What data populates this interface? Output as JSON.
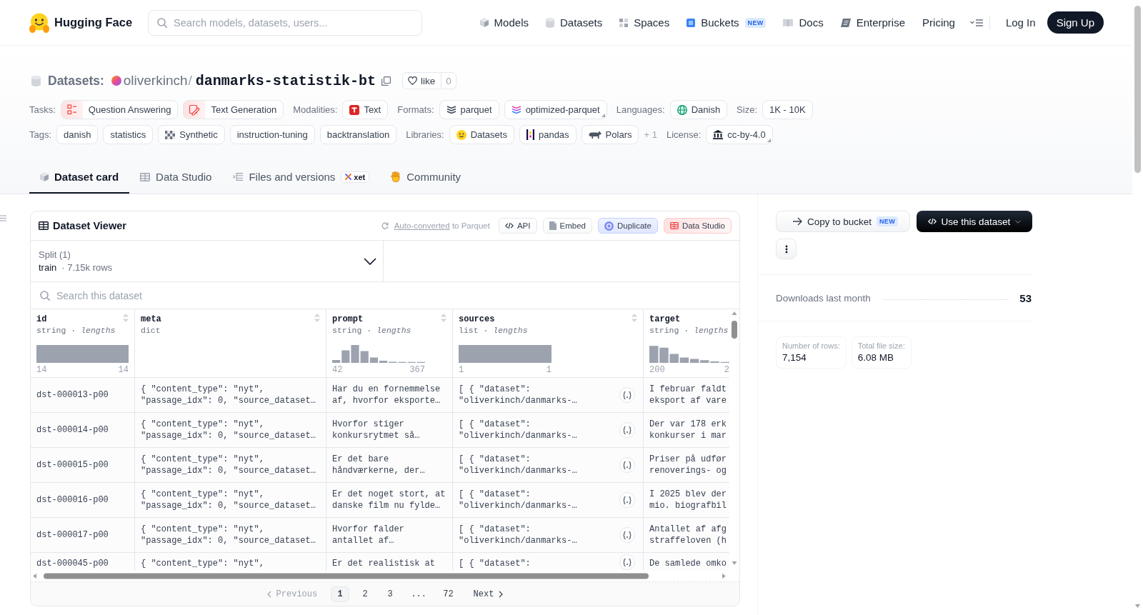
{
  "header": {
    "brand": "Hugging Face",
    "search": {
      "placeholder": "Search models, datasets, users..."
    },
    "nav": [
      {
        "label": "Models"
      },
      {
        "label": "Datasets"
      },
      {
        "label": "Spaces"
      },
      {
        "label": "Buckets",
        "badge": "NEW"
      },
      {
        "label": "Docs"
      },
      {
        "label": "Enterprise"
      },
      {
        "label": "Pricing"
      }
    ],
    "login": "Log In",
    "signup": "Sign Up"
  },
  "repo": {
    "type_label": "Datasets:",
    "owner": "oliverkinch",
    "separator": "/",
    "name": "danmarks-statistik-bt",
    "like": {
      "label": "like",
      "count": "0"
    }
  },
  "metadata": [
    {
      "groups": [
        {
          "label": "Tasks:",
          "chips": [
            {
              "text": "Question Answering"
            },
            {
              "text": "Text Generation"
            }
          ]
        },
        {
          "label": "Modalities:",
          "chips": [
            {
              "text": "Text"
            }
          ]
        },
        {
          "label": "Formats:",
          "chips": [
            {
              "text": "parquet",
              "menu": false
            },
            {
              "text": "optimized-parquet",
              "menu": true
            }
          ]
        },
        {
          "label": "Languages:",
          "chips": [
            {
              "text": "Danish"
            }
          ]
        },
        {
          "label": "Size:",
          "chips": [
            {
              "text": "1K - 10K"
            }
          ]
        }
      ]
    },
    {
      "groups": [
        {
          "label": "Tags:",
          "chips": [
            {
              "text": "danish"
            },
            {
              "text": "statistics"
            },
            {
              "text": "Synthetic"
            },
            {
              "text": "instruction-tuning"
            },
            {
              "text": "backtranslation"
            }
          ]
        },
        {
          "label": "Libraries:",
          "chips": [
            {
              "text": "Datasets"
            },
            {
              "text": "pandas"
            },
            {
              "text": "Polars"
            }
          ],
          "more": "+ 1"
        },
        {
          "label": "License:",
          "chips": [
            {
              "text": "cc-by-4.0",
              "menu": true
            }
          ]
        }
      ]
    }
  ],
  "tabs": [
    {
      "label": "Dataset card",
      "selected": true
    },
    {
      "label": "Data Studio",
      "selected": false
    },
    {
      "label": "Files and versions",
      "badge": "xet",
      "selected": false
    },
    {
      "label": "Community",
      "selected": false
    }
  ],
  "viewer": {
    "title": "Dataset Viewer",
    "conversion": {
      "link": "Auto-converted",
      "text": "to Parquet"
    },
    "actions": [
      {
        "label": "API",
        "kind": "plain"
      },
      {
        "label": "Embed",
        "kind": "plain"
      },
      {
        "label": "Duplicate",
        "kind": "blue"
      },
      {
        "label": "Data Studio",
        "kind": "red"
      }
    ],
    "split": {
      "label": "Split (1)",
      "value": "train",
      "detail": "· 7.15k rows"
    },
    "search": {
      "placeholder": "Search this dataset"
    },
    "columns": [
      {
        "name": "id",
        "subtitle": "string · *lengths*",
        "min": "14",
        "max": "14"
      },
      {
        "name": "meta",
        "subtitle": "dict"
      },
      {
        "name": "prompt",
        "subtitle": "string · *lengths*",
        "min": "42",
        "max": "367"
      },
      {
        "name": "sources",
        "subtitle": "list · *lengths*",
        "min": "1",
        "max": "1"
      },
      {
        "name": "target",
        "subtitle": "string · *lengths*",
        "min": "200",
        "max": "2"
      }
    ],
    "rows": [
      {
        "cells": [
          "dst-000013-p00",
          "{ \"content_type\": \"nyt\", \"passage_idx\": 0, \"source_dataset…",
          "Har du en fornemmelse af, hvorfor eksporte…",
          "[ { \"dataset\": \"oliverkinch/danmarks-…",
          "I februar faldt eksport af vare"
        ]
      },
      {
        "cells": [
          "dst-000014-p00",
          "{ \"content_type\": \"nyt\", \"passage_idx\": 0, \"source_dataset…",
          "Hvorfor stiger konkursrytmet så…",
          "[ { \"dataset\": \"oliverkinch/danmarks-…",
          "Der var 178 erk konkurser i mar"
        ]
      },
      {
        "cells": [
          "dst-000015-p00",
          "{ \"content_type\": \"nyt\", \"passage_idx\": 0, \"source_dataset…",
          "Er det bare håndværkerne, der…",
          "[ { \"dataset\": \"oliverkinch/danmarks-…",
          "Priser på udfør renoverings- og"
        ]
      },
      {
        "cells": [
          "dst-000016-p00",
          "{ \"content_type\": \"nyt\", \"passage_idx\": 0, \"source_dataset…",
          "Er det noget stort, at danske film nu fylde…",
          "[ { \"dataset\": \"oliverkinch/danmarks-…",
          "I 2025 blev der mio. biografbil"
        ]
      },
      {
        "cells": [
          "dst-000017-p00",
          "{ \"content_type\": \"nyt\", \"passage_idx\": 0, \"source_dataset…",
          "Hvorfor falder antallet af…",
          "[ { \"dataset\": \"oliverkinch/danmarks-…",
          "Antallet af afg straffeloven (h"
        ]
      },
      {
        "cells": [
          "dst-000045-p00",
          "{ \"content_type\": \"nyt\",",
          "Er det realistisk at",
          "[ { \"dataset\":",
          "De samlede omko"
        ]
      }
    ],
    "pagination": {
      "previous": {
        "label": "Previous",
        "disabled": true
      },
      "pages": [
        {
          "label": "1",
          "kind": "page",
          "selected": true
        },
        {
          "label": "2",
          "kind": "page",
          "selected": false
        },
        {
          "label": "3",
          "kind": "page",
          "selected": false
        },
        {
          "label": "...",
          "kind": "gap",
          "selected": false
        },
        {
          "label": "72",
          "kind": "page",
          "selected": false
        }
      ],
      "next": {
        "label": "Next",
        "disabled": false
      }
    }
  },
  "sidebar": {
    "copy_button": {
      "label": "Copy to bucket",
      "badge": "NEW"
    },
    "use_button": {
      "label": "Use this dataset"
    },
    "downloads": {
      "label": "Downloads last month",
      "value": "53"
    },
    "stats": [
      {
        "label": "Number of rows:",
        "value": "7,154"
      },
      {
        "label": "Total file size:",
        "value": "6.08 MB"
      }
    ]
  }
}
